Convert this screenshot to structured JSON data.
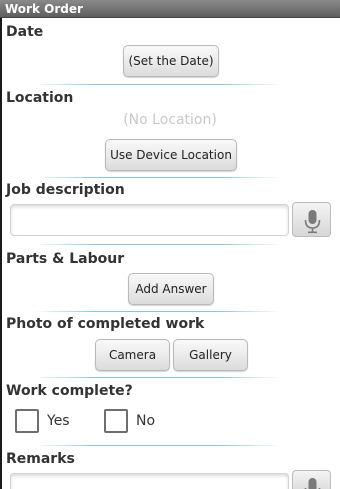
{
  "titlebar": {
    "title": "Work Order"
  },
  "date": {
    "label": "Date",
    "button_label": "(Set the Date)"
  },
  "location": {
    "label": "Location",
    "value_text": "(No Location)",
    "button_label": "Use Device Location"
  },
  "job_description": {
    "label": "Job description",
    "value": "",
    "mic_icon": "microphone-icon"
  },
  "parts_labour": {
    "label": "Parts & Labour",
    "button_label": "Add Answer"
  },
  "photo": {
    "label": "Photo of completed work",
    "camera_label": "Camera",
    "gallery_label": "Gallery"
  },
  "work_complete": {
    "label": "Work complete?",
    "options": [
      {
        "label": "Yes",
        "checked": false
      },
      {
        "label": "No",
        "checked": false
      }
    ]
  },
  "remarks": {
    "label": "Remarks",
    "value": "",
    "mic_icon": "microphone-icon"
  },
  "colors": {
    "titlebar": "#6e6e6e",
    "divider": "#8ac5d8",
    "label_text": "#333333",
    "placeholder_text": "#c9c9c9"
  }
}
